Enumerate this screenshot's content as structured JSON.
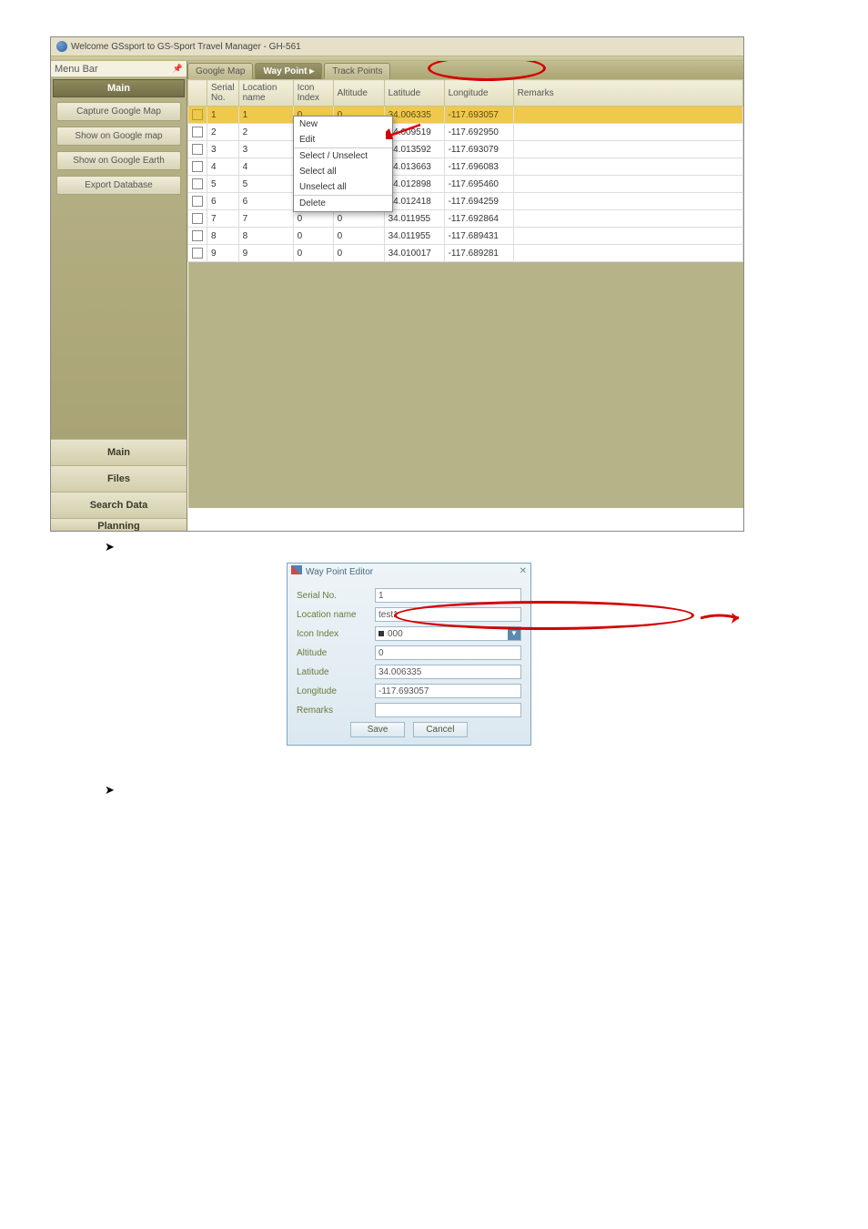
{
  "window_title": "Welcome GSsport to GS-Sport Travel Manager - GH-561",
  "sidebar": {
    "menubar_label": "Menu Bar",
    "main_header": "Main",
    "buttons": [
      "Capture Google Map",
      "Show on Google map",
      "Show on Google Earth",
      "Export Database"
    ],
    "nav": [
      "Main",
      "Files",
      "Search Data",
      "Planning"
    ]
  },
  "tabs": {
    "t1": "Google Map",
    "t2": "Way Point ▸",
    "t3": "Track Points"
  },
  "columns": {
    "c0": "",
    "c1": "Serial No.",
    "c2": "Location name",
    "c3": "Icon Index",
    "c4": "Altitude",
    "c5": "Latitude",
    "c6": "Longitude",
    "c7": "Remarks"
  },
  "rows": [
    {
      "n": "1",
      "loc": "1",
      "icon": "0",
      "alt": "0",
      "lat": "34.006335",
      "lon": "-117.693057",
      "rem": ""
    },
    {
      "n": "2",
      "loc": "2",
      "icon": "",
      "alt": "",
      "lat": "34.009519",
      "lon": "-117.692950",
      "rem": ""
    },
    {
      "n": "3",
      "loc": "3",
      "icon": "",
      "alt": "",
      "lat": "34.013592",
      "lon": "-117.693079",
      "rem": ""
    },
    {
      "n": "4",
      "loc": "4",
      "icon": "",
      "alt": "",
      "lat": "34.013663",
      "lon": "-117.696083",
      "rem": ""
    },
    {
      "n": "5",
      "loc": "5",
      "icon": "",
      "alt": "",
      "lat": "34.012898",
      "lon": "-117.695460",
      "rem": ""
    },
    {
      "n": "6",
      "loc": "6",
      "icon": "",
      "alt": "",
      "lat": "34.012418",
      "lon": "-117.694259",
      "rem": ""
    },
    {
      "n": "7",
      "loc": "7",
      "icon": "0",
      "alt": "0",
      "lat": "34.011955",
      "lon": "-117.692864",
      "rem": ""
    },
    {
      "n": "8",
      "loc": "8",
      "icon": "0",
      "alt": "0",
      "lat": "34.011955",
      "lon": "-117.689431",
      "rem": ""
    },
    {
      "n": "9",
      "loc": "9",
      "icon": "0",
      "alt": "0",
      "lat": "34.010017",
      "lon": "-117.689281",
      "rem": ""
    }
  ],
  "ctx": {
    "m1": "New",
    "m2": "Edit",
    "m3": "Select / Unselect",
    "m4": "Select all",
    "m5": "Unselect all",
    "m6": "Delete"
  },
  "dialog": {
    "title": "Way Point Editor",
    "labels": {
      "serial": "Serial No.",
      "loc": "Location name",
      "icon": "Icon Index",
      "alt": "Altitude",
      "lat": "Latitude",
      "lon": "Longitude",
      "rem": "Remarks",
      "save": "Save",
      "cancel": "Cancel"
    },
    "vals": {
      "serial": "1",
      "loc": "test1",
      "icon": "000",
      "alt": "0",
      "lat": "34.006335",
      "lon": "-117.693057",
      "rem": ""
    }
  },
  "bullet": "➤"
}
